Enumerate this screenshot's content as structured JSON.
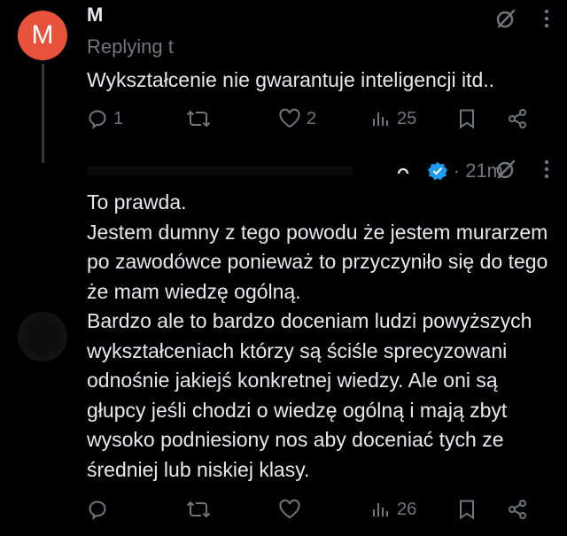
{
  "tweets": [
    {
      "avatar_letter": "M",
      "name": "M",
      "replying": "Replying t",
      "text": "Wykształcenie nie gwarantuje inteligencji itd..",
      "actions": {
        "replies": "1",
        "retweets": "",
        "likes": "2",
        "views": "25"
      }
    },
    {
      "time": "· 21m",
      "text": "To prawda.\nJestem dumny z tego powodu że jestem murarzem po zawodówce ponieważ to przyczyniło się do tego że mam wiedzę ogólną.\nBardzo ale to bardzo doceniam ludzi powyższych wykształceniach którzy są ściśle sprecyzowani odnośnie jakiejś konkretnej wiedzy. Ale oni są głupcy jeśli chodzi o wiedzę ogólną i mają zbyt wysoko podniesiony nos aby doceniać tych ze średniej lub niskiej klasy.",
      "actions": {
        "replies": "",
        "retweets": "",
        "likes": "",
        "views": "26"
      }
    }
  ],
  "colors": {
    "avatar_m": "#e8513a",
    "muted": "#71767b",
    "text": "#e7e9ea",
    "verified": "#1d9bf0"
  }
}
